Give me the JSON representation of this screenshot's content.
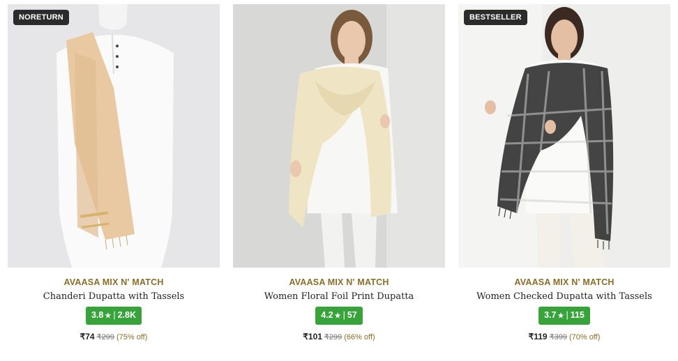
{
  "products": [
    {
      "tag": "NORETURN",
      "brand": "AVAASA MIX N' MATCH",
      "title": "Chanderi Dupatta with Tassels",
      "rating": "3.8",
      "star": "★",
      "reviews": "2.8K",
      "price": "₹74",
      "mrp": "₹299",
      "discount": "(75% off)",
      "image": "peach-dupatta-on-mannequin"
    },
    {
      "tag": "",
      "brand": "AVAASA MIX N' MATCH",
      "title": "Women Floral Foil Print Dupatta",
      "rating": "4.2",
      "star": "★",
      "reviews": "57",
      "price": "₹101",
      "mrp": "₹299",
      "discount": "(66% off)",
      "image": "cream-dupatta-on-model"
    },
    {
      "tag": "BESTSELLER",
      "brand": "AVAASA MIX N' MATCH",
      "title": "Women Checked Dupatta with Tassels",
      "rating": "3.7",
      "star": "★",
      "reviews": "115",
      "price": "₹119",
      "mrp": "₹399",
      "discount": "(70% off)",
      "image": "black-checked-dupatta-on-model"
    }
  ],
  "colors": {
    "brand": "#8a6d2a",
    "rating_bg": "#37a33a",
    "tag_bg": "#2b2b2b"
  }
}
